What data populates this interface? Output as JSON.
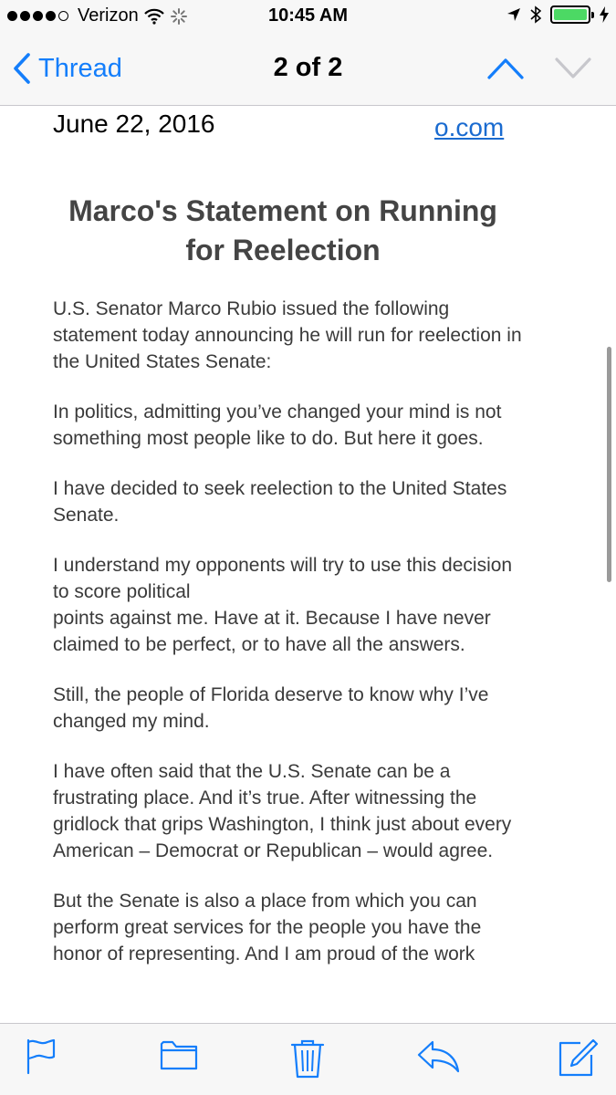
{
  "status_bar": {
    "carrier": "Verizon",
    "time": "10:45 AM",
    "battery_color": "#4cd964"
  },
  "nav": {
    "back_label": "Thread",
    "title": "2 of 2",
    "accent": "#147efb"
  },
  "email": {
    "date": "June 22, 2016",
    "link_text": "o.com",
    "headline": "Marco's Statement on Running for Reelection",
    "paragraphs": [
      "U.S. Senator Marco Rubio issued the following statement today announcing he will run for reelection in the United States Senate:",
      "In politics, admitting you’ve changed your mind is not something most people like to do. But here it goes.",
      "I have decided to seek reelection to the United States Senate.",
      "I understand my opponents will try to use this decision to score political\npoints against me. Have at it. Because I have never claimed to be perfect, or to have all the answers.",
      "Still, the people of Florida deserve to know why I’ve changed my mind.",
      "I have often said that the U.S. Senate can be a frustrating place. And it’s true. After witnessing the gridlock that grips Washington, I think just about every American – Democrat or Republican – would agree.",
      "But the Senate is also a place from which you can perform great services for the people you have the honor of representing. And I am proud of the work"
    ]
  },
  "toolbar": {
    "icons": [
      "flag-icon",
      "folder-icon",
      "trash-icon",
      "reply-icon",
      "compose-icon"
    ]
  }
}
